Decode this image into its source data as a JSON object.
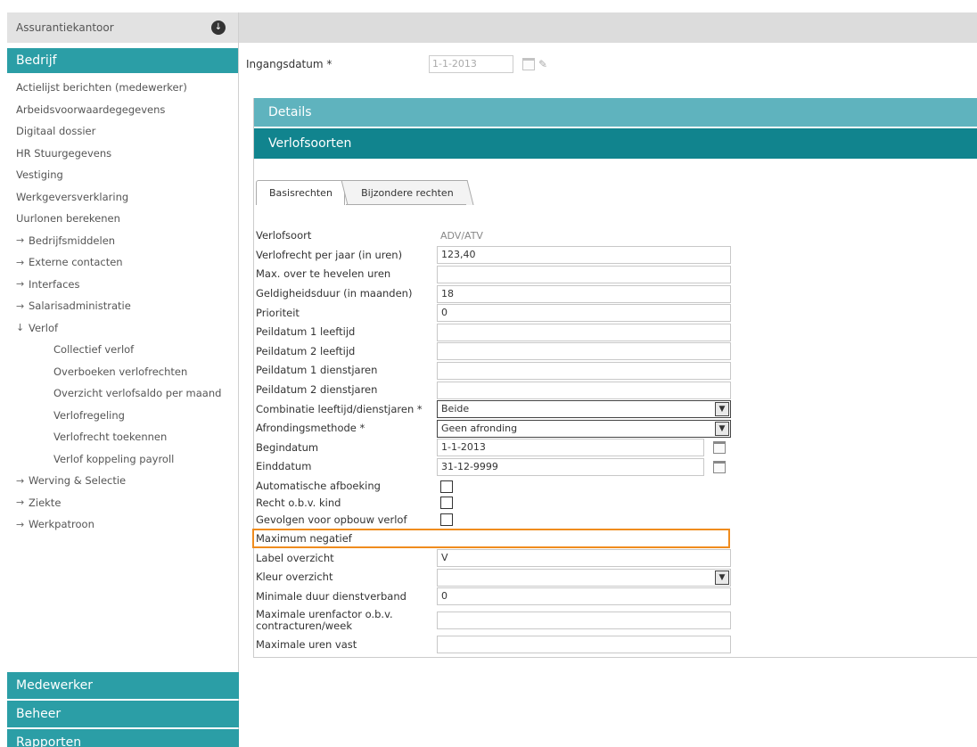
{
  "sidebar": {
    "org": "Assurantiekantoor",
    "section_bedrijf": "Bedrijf",
    "items": [
      {
        "label": "Actielijst berichten (medewerker)",
        "level": 0,
        "arrow": ""
      },
      {
        "label": "Arbeidsvoorwaardegegevens",
        "level": 0,
        "arrow": ""
      },
      {
        "label": "Digitaal dossier",
        "level": 0,
        "arrow": ""
      },
      {
        "label": "HR Stuurgegevens",
        "level": 0,
        "arrow": ""
      },
      {
        "label": "Vestiging",
        "level": 0,
        "arrow": ""
      },
      {
        "label": "Werkgeversverklaring",
        "level": 0,
        "arrow": ""
      },
      {
        "label": "Uurlonen berekenen",
        "level": 0,
        "arrow": ""
      },
      {
        "label": "Bedrijfsmiddelen",
        "level": 0,
        "arrow": "→"
      },
      {
        "label": "Externe contacten",
        "level": 0,
        "arrow": "→"
      },
      {
        "label": "Interfaces",
        "level": 0,
        "arrow": "→"
      },
      {
        "label": "Salarisadministratie",
        "level": 0,
        "arrow": "→"
      },
      {
        "label": "Verlof",
        "level": 0,
        "arrow": "↓"
      },
      {
        "label": "Collectief verlof",
        "level": 1,
        "arrow": ""
      },
      {
        "label": "Overboeken verlofrechten",
        "level": 1,
        "arrow": ""
      },
      {
        "label": "Overzicht verlofsaldo per maand",
        "level": 1,
        "arrow": ""
      },
      {
        "label": "Verlofregeling",
        "level": 1,
        "arrow": ""
      },
      {
        "label": "Verlofrecht toekennen",
        "level": 1,
        "arrow": ""
      },
      {
        "label": "Verlof koppeling payroll",
        "level": 1,
        "arrow": ""
      },
      {
        "label": "Werving & Selectie",
        "level": 0,
        "arrow": "→"
      },
      {
        "label": "Ziekte",
        "level": 0,
        "arrow": "→"
      },
      {
        "label": "Werkpatroon",
        "level": 0,
        "arrow": "→"
      }
    ],
    "section_medewerker": "Medewerker",
    "section_beheer": "Beheer",
    "section_rapporten": "Rapporten"
  },
  "header": {
    "ingang_label": "Ingangsdatum *",
    "ingang_value": "1-1-2013"
  },
  "panels": {
    "details": "Details",
    "verlofsoorten": "Verlofsoorten"
  },
  "tabs": {
    "basis": "Basisrechten",
    "bijzonder": "Bijzondere rechten"
  },
  "form": {
    "verlofsoort_label": "Verlofsoort",
    "verlofsoort_value": "ADV/ATV",
    "verlofrecht_label": "Verlofrecht per jaar (in uren)",
    "verlofrecht_value": "123,40",
    "max_over_label": "Max. over te hevelen uren",
    "max_over_value": "",
    "geldigheid_label": "Geldigheidsduur (in maanden)",
    "geldigheid_value": "18",
    "prioriteit_label": "Prioriteit",
    "prioriteit_value": "0",
    "peil1_leeftijd_label": "Peildatum 1 leeftijd",
    "peil2_leeftijd_label": "Peildatum 2 leeftijd",
    "peil1_dienst_label": "Peildatum 1 dienstjaren",
    "peil2_dienst_label": "Peildatum 2 dienstjaren",
    "combinatie_label": "Combinatie leeftijd/dienstjaren *",
    "combinatie_value": "Beide",
    "afronding_label": "Afrondingsmethode *",
    "afronding_value": "Geen afronding",
    "begindatum_label": "Begindatum",
    "begindatum_value": "1-1-2013",
    "einddatum_label": "Einddatum",
    "einddatum_value": "31-12-9999",
    "auto_afboeking_label": "Automatische afboeking",
    "recht_kind_label": "Recht o.b.v. kind",
    "gevolgen_label": "Gevolgen voor opbouw verlof",
    "max_negatief_label": "Maximum negatief",
    "max_negatief_value": "",
    "label_overzicht_label": "Label overzicht",
    "label_overzicht_value": "V",
    "kleur_label": "Kleur overzicht",
    "kleur_value": "",
    "min_duur_label": "Minimale duur dienstverband",
    "min_duur_value": "0",
    "max_urenfactor_label": "Maximale urenfactor o.b.v. contracturen/week",
    "max_urenfactor_value": "",
    "max_uren_vast_label": "Maximale uren vast",
    "max_uren_vast_value": ""
  },
  "colors": {
    "teal_dark": "#11848e",
    "teal_light": "#5fb3be",
    "teal_nav": "#2b9ea6",
    "highlight": "#f08c1e"
  }
}
